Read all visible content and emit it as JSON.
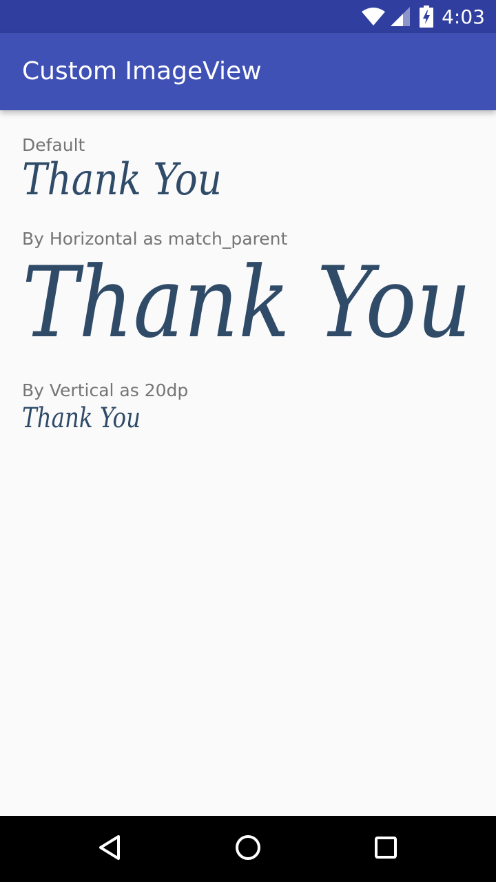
{
  "status_bar": {
    "time": "4:03",
    "icons": [
      "wifi-icon",
      "cellular-signal-icon",
      "battery-charging-icon"
    ]
  },
  "app_bar": {
    "title": "Custom ImageView",
    "color": "#3f51b5"
  },
  "content": {
    "sections": [
      {
        "label": "Default",
        "image_text": "Thank You"
      },
      {
        "label": "By Horizontal as match_parent",
        "image_text": "Thank You"
      },
      {
        "label": "By Vertical as 20dp",
        "image_text": "Thank You"
      }
    ]
  },
  "nav_bar": {
    "icons": [
      "back-icon",
      "home-icon",
      "recents-icon"
    ]
  },
  "colors": {
    "status_bar": "#303f9f",
    "text_secondary": "#757575",
    "image_ink": "#2f4b68"
  }
}
